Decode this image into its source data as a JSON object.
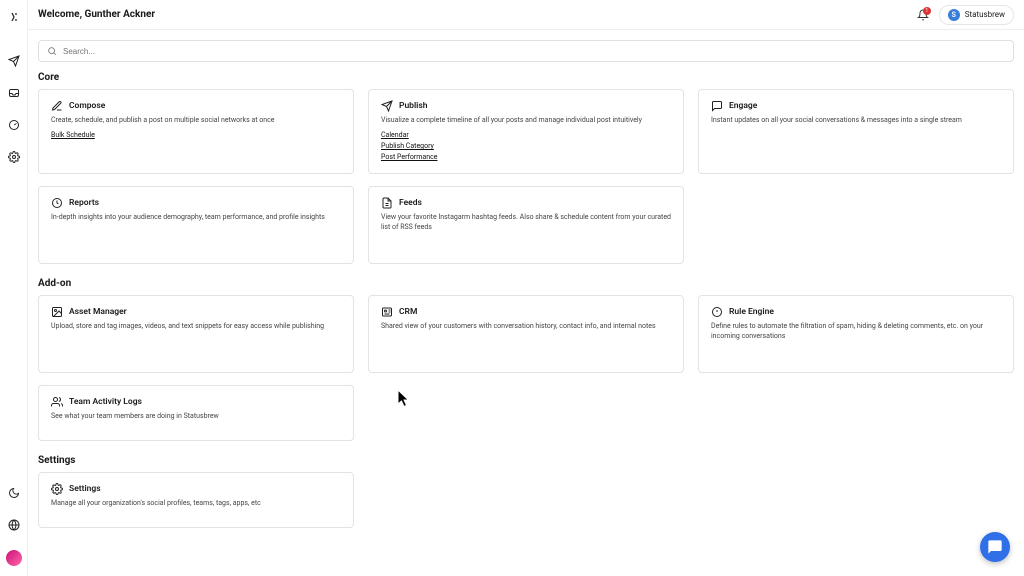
{
  "header": {
    "title": "Welcome, Gunther Ackner",
    "notification_count": "1",
    "brand_initial": "S",
    "brand_name": "Statusbrew"
  },
  "search": {
    "placeholder": "Search..."
  },
  "sections": {
    "core": {
      "title": "Core",
      "compose": {
        "title": "Compose",
        "desc": "Create, schedule, and publish a post on multiple social networks at once",
        "link_bulk": "Bulk Schedule"
      },
      "publish": {
        "title": "Publish",
        "desc": "Visualize a complete timeline of all your posts and manage individual post intuitively",
        "link_calendar": "Calendar",
        "link_category": "Publish Category",
        "link_perf": "Post Performance"
      },
      "engage": {
        "title": "Engage",
        "desc": "Instant updates on all your social conversations & messages into a single stream"
      },
      "reports": {
        "title": "Reports",
        "desc": "In-depth insights into your audience demography, team performance, and profile insights"
      },
      "feeds": {
        "title": "Feeds",
        "desc": "View your favorite Instagarm hashtag feeds. Also share & schedule content from your curated list of RSS feeds"
      }
    },
    "addon": {
      "title": "Add-on",
      "asset": {
        "title": "Asset Manager",
        "desc": "Upload, store and tag images, videos, and text snippets for easy access while publishing"
      },
      "crm": {
        "title": "CRM",
        "desc": "Shared view of your customers with conversation history, contact info, and internal notes"
      },
      "rule": {
        "title": "Rule Engine",
        "desc": "Define rules to automate the filtration of spam, hiding & deleting comments, etc. on your incoming conversations"
      },
      "activity": {
        "title": "Team Activity Logs",
        "desc": "See what your team members are doing in Statusbrew"
      }
    },
    "settings": {
      "title": "Settings",
      "card": {
        "title": "Settings",
        "desc": "Manage all your organization's social profiles, teams, tags, apps, etc"
      }
    }
  }
}
